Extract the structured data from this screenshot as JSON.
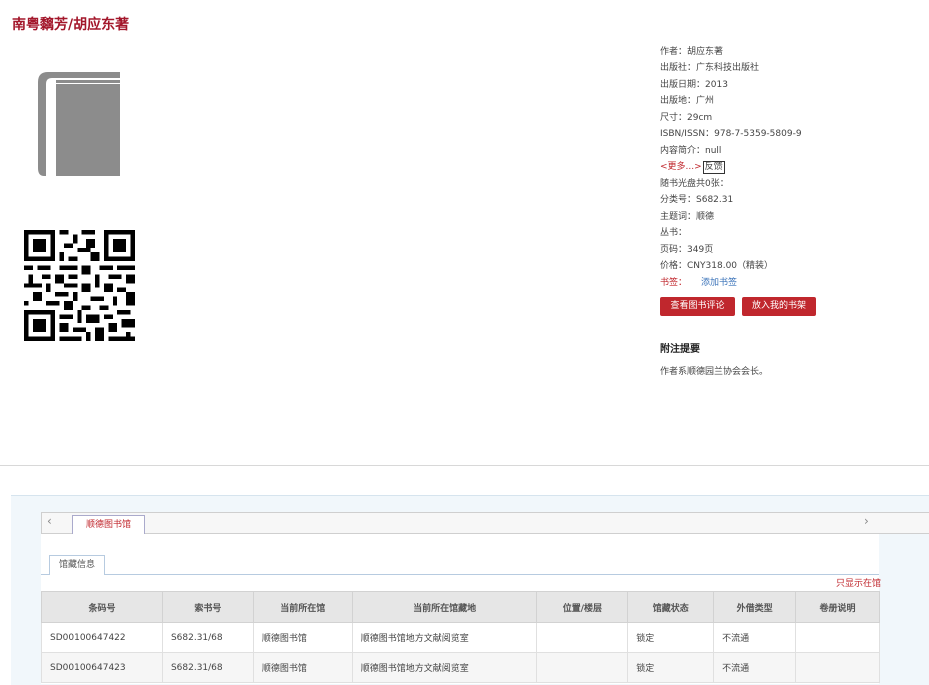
{
  "book": {
    "title": "南粤黐芳/胡应东著"
  },
  "meta": {
    "author_label": "作者：",
    "author": "胡应东著",
    "publisher_label": "出版社：",
    "publisher": "广东科技出版社",
    "pubdate_label": "出版日期：",
    "pubdate": "2013",
    "place_label": "出版地：",
    "place": "广州",
    "size_label": "尺寸：",
    "size": "29cm",
    "isbn_label": "ISBN/ISSN：",
    "isbn": "978-7-5359-5809-9",
    "summary_label": "内容简介：",
    "summary": "null",
    "more_link": "<更多...>",
    "feedback": "反馈",
    "disc_label": "随书光盘共0张：",
    "class_label": "分类号：",
    "class": "S682.31",
    "subject_label": "主题词：",
    "subject": "顺德",
    "series_label": "丛书：",
    "pages_label": "页码：",
    "pages": "349页",
    "price_label": "价格：",
    "price": "CNY318.00（精装）",
    "tags_label": "书签：",
    "add_tag": "添加书签"
  },
  "buttons": {
    "review": "查看图书评论",
    "shelf": "放入我的书架"
  },
  "notes": {
    "title": "附注提要",
    "text": "作者系顺德园兰协会会长。"
  },
  "holdings": {
    "tab_library": "顺德图书馆",
    "subtab": "馆藏信息",
    "only_show": "只显示在馆",
    "headers": [
      "条码号",
      "索书号",
      "当前所在馆",
      "当前所在馆藏地",
      "位置/楼层",
      "馆藏状态",
      "外借类型",
      "卷册说明"
    ],
    "rows": [
      [
        "SD00100647422",
        "S682.31/68",
        "顺德图书馆",
        "顺德图书馆地方文献阅览室",
        "",
        "锁定",
        "不流通",
        ""
      ],
      [
        "SD00100647423",
        "S682.31/68",
        "顺德图书馆",
        "顺德图书馆地方文献阅览室",
        "",
        "锁定",
        "不流通",
        ""
      ]
    ]
  },
  "colors": {
    "accent": "#c0272d",
    "title": "#a3172b"
  },
  "icons": {
    "book": "book-icon",
    "qr": "qr-code-icon",
    "prev": "chevron-left-icon",
    "next": "chevron-right-icon"
  }
}
